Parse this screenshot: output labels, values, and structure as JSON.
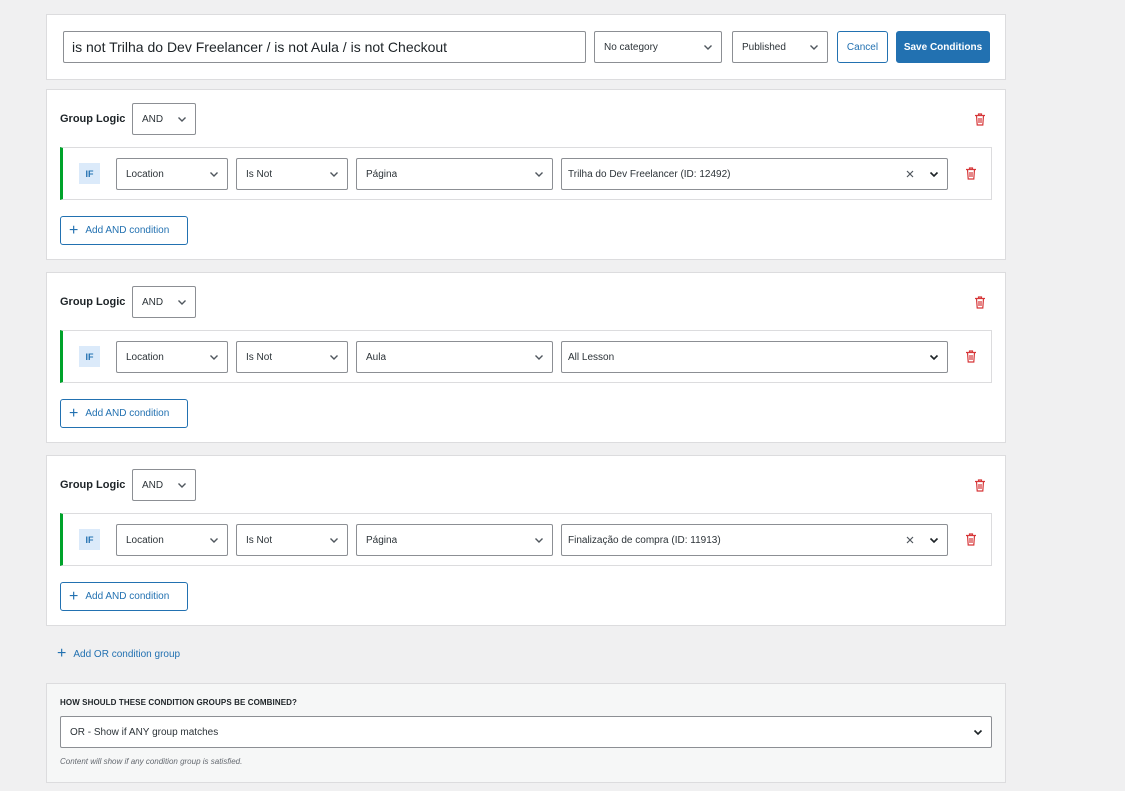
{
  "header": {
    "title_value": "is not Trilha do Dev Freelancer / is not Aula / is not Checkout",
    "category_select": "No category",
    "status_select": "Published",
    "cancel_label": "Cancel",
    "save_label": "Save Conditions"
  },
  "groups": [
    {
      "logic_label": "Group Logic",
      "logic_value": "AND",
      "condition": {
        "if_label": "IF",
        "field": "Location",
        "operator": "Is Not",
        "type": "Página",
        "value": "Trilha do Dev Freelancer (ID: 12492)"
      },
      "add_and_label": "Add AND condition"
    },
    {
      "logic_label": "Group Logic",
      "logic_value": "AND",
      "condition": {
        "if_label": "IF",
        "field": "Location",
        "operator": "Is Not",
        "type": "Aula",
        "value": "All Lesson"
      },
      "add_and_label": "Add AND condition"
    },
    {
      "logic_label": "Group Logic",
      "logic_value": "AND",
      "condition": {
        "if_label": "IF",
        "field": "Location",
        "operator": "Is Not",
        "type": "Página",
        "value": "Finalização de compra (ID: 11913)"
      },
      "add_and_label": "Add AND condition"
    }
  ],
  "add_or_label": "Add OR condition group",
  "combine": {
    "heading": "HOW SHOULD THESE CONDITION GROUPS BE COMBINED?",
    "select_value": "OR - Show if ANY group matches",
    "help": "Content will show if any condition group is satisfied."
  },
  "icons": {
    "chevron": "chevron-down-icon",
    "trash": "trash-icon",
    "clear": "close-icon",
    "plus": "plus-icon"
  },
  "colors": {
    "primary": "#2271b1",
    "delete": "#d63638",
    "active_border": "#00a32a",
    "if_badge_bg": "#dbeafa"
  }
}
